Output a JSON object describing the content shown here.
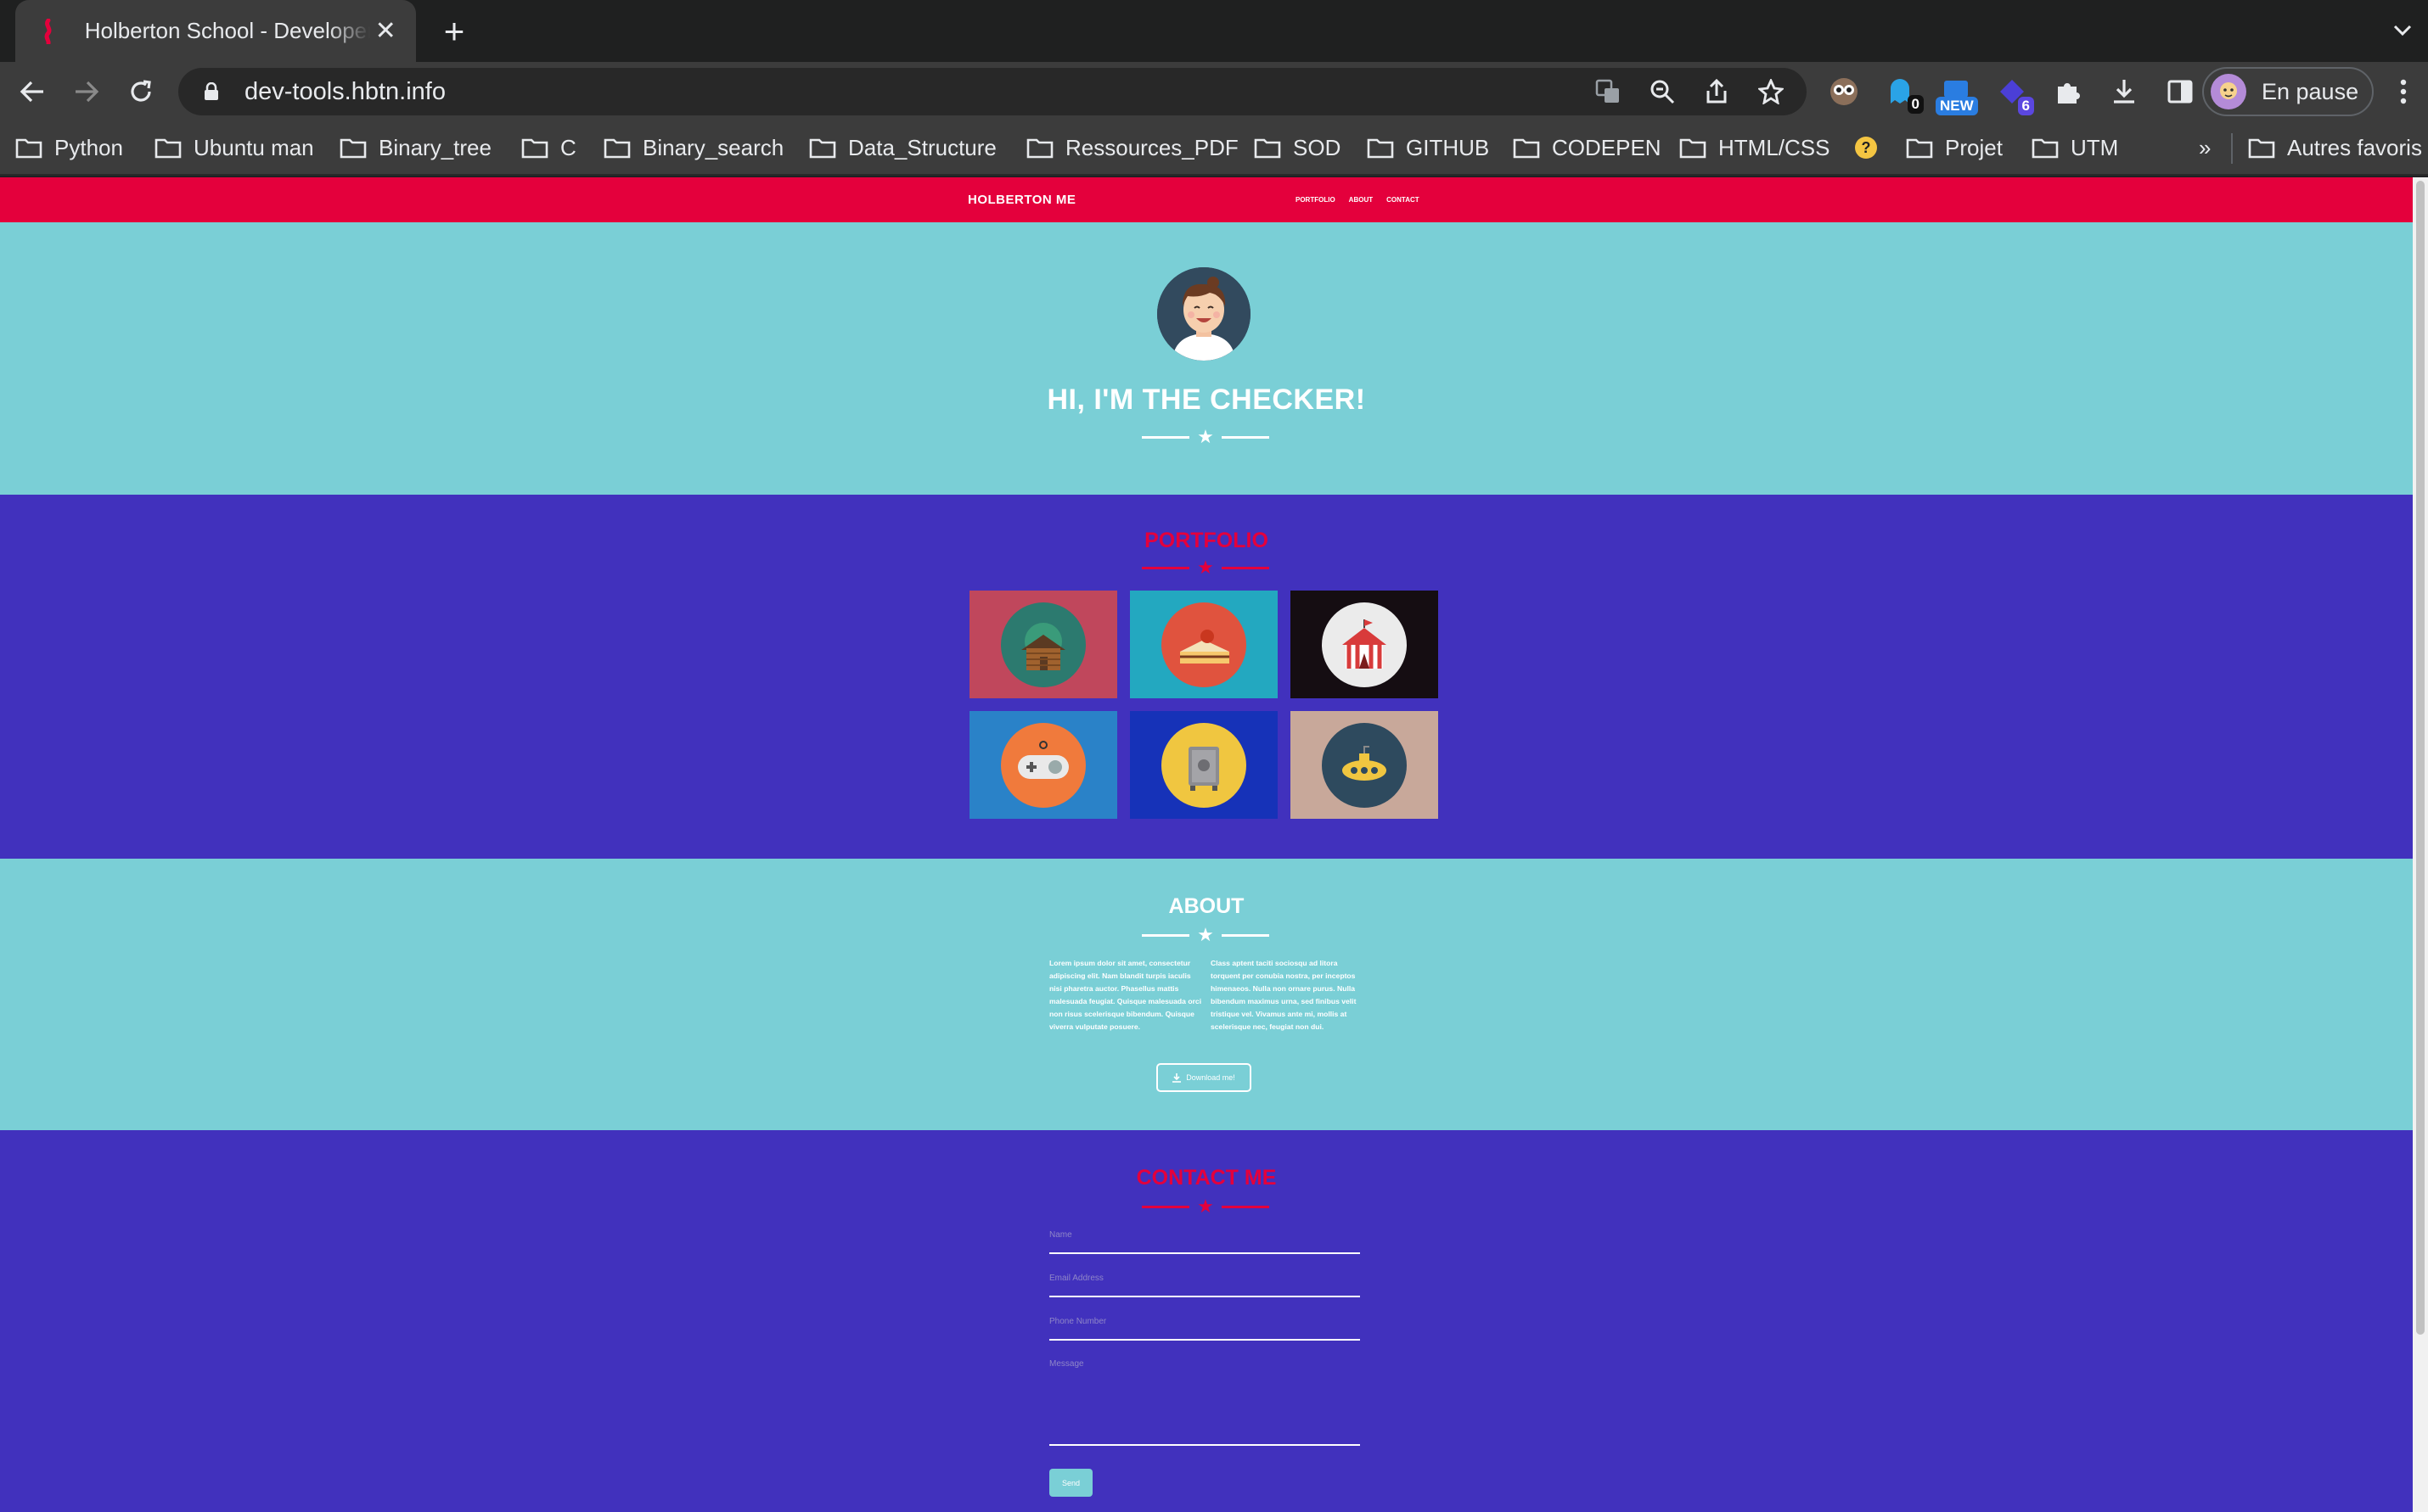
{
  "browser": {
    "tab": {
      "title": "Holberton School - Developer tools"
    },
    "address": {
      "url": "dev-tools.hbtn.info"
    },
    "extensions": {
      "badge_blue": "0",
      "badge_new": "NEW",
      "badge_count": "6"
    },
    "profile": {
      "label": "En pause"
    },
    "bookmarks": [
      {
        "label": "Python"
      },
      {
        "label": "Ubuntu man"
      },
      {
        "label": "Binary_tree"
      },
      {
        "label": "C"
      },
      {
        "label": "Binary_search"
      },
      {
        "label": "Data_Structure"
      },
      {
        "label": "Ressources_PDF"
      },
      {
        "label": "SOD"
      },
      {
        "label": "GITHUB"
      },
      {
        "label": "CODEPEN"
      },
      {
        "label": "HTML/CSS"
      },
      {
        "label": "Projet"
      },
      {
        "label": "UTM"
      }
    ],
    "bookmarks_overflow": "»",
    "other_bookmarks": "Autres favoris"
  },
  "site": {
    "brand": "HOLBERTON ME",
    "nav": [
      {
        "label": "PORTFOLIO"
      },
      {
        "label": "ABOUT"
      },
      {
        "label": "CONTACT"
      }
    ],
    "hero": {
      "title": "HI, I'M THE CHECKER!"
    },
    "portfolio": {
      "title": "PORTFOLIO",
      "items": [
        {
          "icon": "cabin-icon",
          "bg": "#c0475c"
        },
        {
          "icon": "cake-icon",
          "bg": "#23a8c0"
        },
        {
          "icon": "circus-tent-icon",
          "bg": "#150d12"
        },
        {
          "icon": "game-controller-icon",
          "bg": "#2a82c8"
        },
        {
          "icon": "safe-icon",
          "bg": "#1632b8"
        },
        {
          "icon": "submarine-icon",
          "bg": "#c8a89a"
        }
      ]
    },
    "about": {
      "title": "ABOUT",
      "col_left": "Lorem ipsum dolor sit amet, consectetur adipiscing elit. Nam blandit turpis iaculis nisi pharetra auctor. Phasellus mattis malesuada feugiat. Quisque malesuada orci non risus scelerisque bibendum. Quisque viverra vulputate posuere.",
      "col_right": "Class aptent taciti sociosqu ad litora torquent per conubia nostra, per inceptos himenaeos. Nulla non ornare purus. Nulla bibendum maximus urna, sed finibus velit tristique vel. Vivamus ante mi, mollis at scelerisque nec, feugiat non dui.",
      "download_label": "Download me!"
    },
    "contact": {
      "title": "CONTACT ME",
      "name_placeholder": "Name",
      "email_placeholder": "Email Address",
      "phone_placeholder": "Phone Number",
      "message_placeholder": "Message",
      "send_label": "Send"
    }
  },
  "colors": {
    "nav_red": "#e4003c",
    "teal": "#7acfd6",
    "indigo": "#4131bd"
  }
}
